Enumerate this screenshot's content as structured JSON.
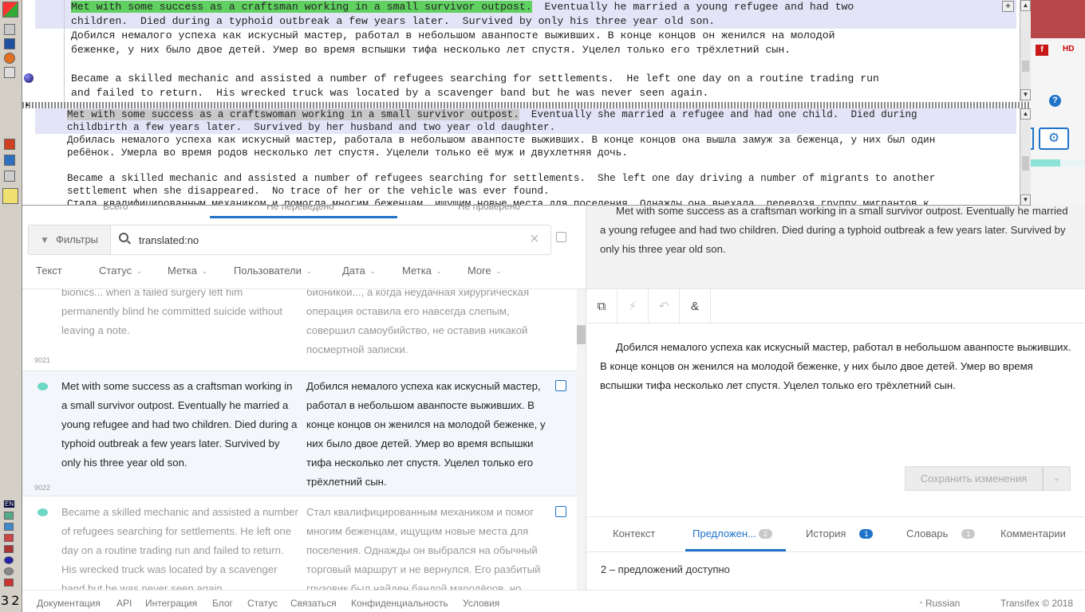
{
  "taskbar": {
    "clock": "3 2",
    "keyboard_layout": "EN"
  },
  "editor": {
    "top_lines": [
      {
        "highlight": "Met with some success as a craftsman working in a small survivor outpost.",
        "rest": "  Eventually he married a young refugee and had two"
      },
      {
        "highlight": "",
        "rest": "children.  Died during a typhoid outbreak a few years later.  Survived by only his three year old son."
      },
      {
        "highlight": "",
        "rest": "Добился немалого успеха как искусный мастер, работал в небольшом аванпосте выживших. В конце концов он женился на молодой"
      },
      {
        "highlight": "",
        "rest": "беженке, у них было двое детей. Умер во время вспышки тифа несколько лет спустя. Уцелел только его трёхлетний сын."
      },
      {
        "highlight": "",
        "rest": ""
      },
      {
        "highlight": "",
        "rest": "Became a skilled mechanic and assisted a number of refugees searching for settlements.  He left one day on a routine trading run"
      },
      {
        "highlight": "",
        "rest": "and failed to return.  His wrecked truck was located by a scavenger band but he was never seen again."
      }
    ],
    "bottom_lines": [
      {
        "highlight": "Met with some success as a craftswoman working in a small survivor outpost.",
        "rest": "  Eventually she married a refugee and had one child.  Died during"
      },
      {
        "highlight": "",
        "rest": "childbirth a few years later.  Survived by her husband and two year old daughter."
      },
      {
        "highlight": "",
        "rest": "Добилась немалого успеха как искусный мастер, работала в небольшом аванпосте выживших. В конце концов она вышла замуж за беженца, у них был один"
      },
      {
        "highlight": "",
        "rest": "ребёнок. Умерла во время родов несколько лет спустя. Уцелели только её муж и двухлетняя дочь."
      },
      {
        "highlight": "",
        "rest": ""
      },
      {
        "highlight": "",
        "rest": "Became a skilled mechanic and assisted a number of refugees searching for settlements.  She left one day driving a number of migrants to another"
      },
      {
        "highlight": "",
        "rest": "settlement when she disappeared.  No trace of her or the vehicle was ever found."
      },
      {
        "highlight": "",
        "rest": "Стала квалифицированным механиком и помогла многим беженцам, ищущим новые места для поселения. Однажды она выехала, перевозя группу мигрантов к"
      }
    ],
    "plus_label": "+"
  },
  "browser_icons": {
    "flash": "f",
    "hd": "HD",
    "help": "?"
  },
  "tabs": {
    "all": "Всего",
    "untranslated": "Не переведено",
    "unreviewed": "Не проверено"
  },
  "filter": {
    "button_label": "Фильтры",
    "search_value": "translated:no",
    "clear": "×"
  },
  "facets": [
    "Текст",
    "Статус",
    "Метка",
    "Пользователи",
    "Дата",
    "Метка",
    "More"
  ],
  "rows": [
    {
      "id": "9021",
      "source": "bionics... when a failed surgery left him permanently blind he committed suicide without leaving a note.",
      "target": "бионикой..., а когда неудачная хирургическая операция оставила его навсегда слепым, совершил самоубийство, не оставив никакой посмертной записки."
    },
    {
      "id": "9022",
      "source": "Met with some success as a craftsman working in a small survivor outpost. Eventually he married a young refugee and had two children. Died during a typhoid outbreak a few years later. Survived by only his three year old son.",
      "target": "Добился немалого успеха как искусный мастер, работал в небольшом аванпосте выживших. В конце концов он женился на молодой беженке, у них было двое детей. Умер во время вспышки тифа несколько лет спустя. Уцелел только его трёхлетний сын."
    },
    {
      "id": "",
      "source": "Became a skilled mechanic and assisted a number of refugees searching for settlements. He left one day on a routine trading run and failed to return. His wrecked truck was located by a scavenger band but he was never seen again.",
      "target": "Стал квалифицированным механиком и помог многим беженцам, ищущим новые места для поселения. Однажды он выбрался на обычный торговый маршрут и не вернулся. Его разбитый грузовик был найден бандой мародёров, но самого его больше никто не видел."
    }
  ],
  "detail": {
    "source_text": "Met with some success as a craftsman working in a small survivor outpost.  Eventually he married a young refugee and had two children.  Died during a typhoid outbreak a few years later.  Survived by only his three year old son.",
    "target_text": "Добился немалого успеха как искусный мастер, работал в небольшом аванпосте выживших. В конце концов он женился на молодой беженке, у них было двое детей. Умер во время вспышки тифа несколько лет спустя. Уцелел только его трёхлетний сын.",
    "save_label": "Сохранить изменения",
    "tabs": {
      "context": "Контекст",
      "suggestions": "Предложен...",
      "suggestions_count": "2",
      "history": "История",
      "history_count": "1",
      "glossary": "Словарь",
      "glossary_count": "1",
      "comments": "Комментарии"
    },
    "suggestions_available": "2 – предложений доступно"
  },
  "footer": {
    "links": [
      "Документация",
      "API",
      "Интеграция",
      "Блог",
      "Статус",
      "Связаться",
      "Конфиденциальность",
      "Условия"
    ],
    "language": "Russian",
    "copyright": "Transifex © 2018"
  },
  "colors": {
    "accent": "#1f73c8",
    "teal_status": "#6dd8c4",
    "editor_highlight": "#60d060"
  }
}
